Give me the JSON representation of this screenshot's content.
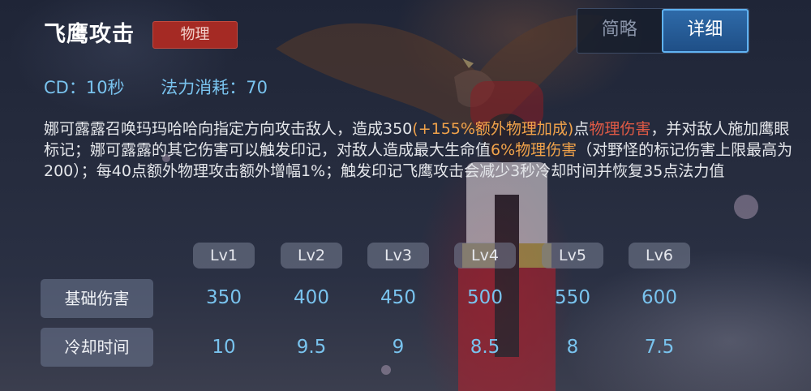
{
  "skill": {
    "name": "飞鹰攻击",
    "damage_type": "物理"
  },
  "tabs": [
    {
      "label": "简略",
      "active": false
    },
    {
      "label": "详细",
      "active": true
    }
  ],
  "stats": {
    "cd": "CD：10秒",
    "mana_cost": "法力消耗：70"
  },
  "description": {
    "seg1": "娜可露露召唤玛玛哈哈向指定方向攻击敌人，造成350",
    "seg2": "(+155%额外物理加成)",
    "seg3": "点",
    "seg4": "物理伤害",
    "seg5": "，并对敌人施加鹰眼标记；娜可露露的其它伤害可以触发印记，对敌人造成最大生命值",
    "seg6": "6%物理伤害",
    "seg7": "（对野怪的标记伤害上限最高为200）；每40点额外物理攻击额外增幅1%；触发印记飞鹰攻击会减少3秒冷却时间并恢复35点法力值",
    "colors": {
      "bonus": "#f0a24a",
      "damage": "#e15a45",
      "text": "#e4e6ea"
    }
  },
  "levels": [
    "Lv1",
    "Lv2",
    "Lv3",
    "Lv4",
    "Lv5",
    "Lv6"
  ],
  "rows": [
    {
      "label": "基础伤害",
      "values": [
        "350",
        "400",
        "450",
        "500",
        "550",
        "600"
      ]
    },
    {
      "label": "冷却时间",
      "values": [
        "10",
        "9.5",
        "9",
        "8.5",
        "8",
        "7.5"
      ]
    }
  ],
  "colors": {
    "stat_blue": "#79c3ee",
    "badge_red": "#a52a24",
    "tab_active": "#2e6aa8"
  }
}
